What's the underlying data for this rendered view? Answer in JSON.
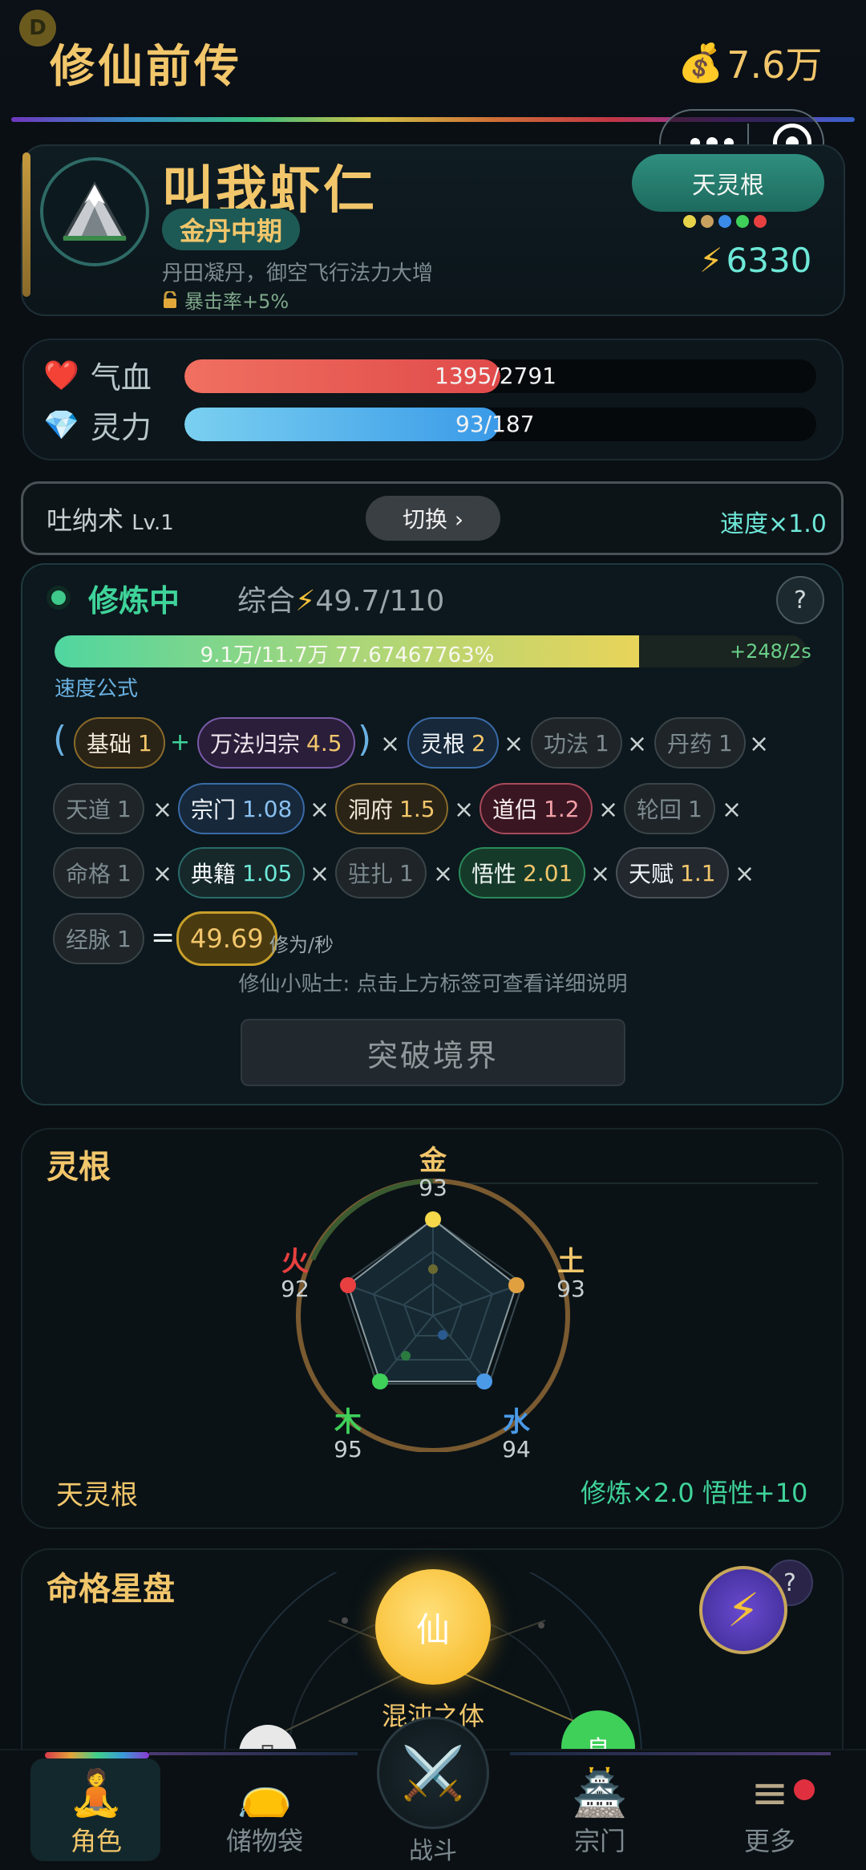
{
  "header": {
    "badge": "D",
    "title": "修仙前传",
    "money_icon": "money-bag-icon",
    "money": "7.6万"
  },
  "mini_program": {
    "more_icon": "more-dots-icon",
    "close_icon": "target-close-icon"
  },
  "profile": {
    "name": "叫我虾仁",
    "realm": "金丹中期",
    "realm_desc": "丹田凝丹，御空飞行法力大增",
    "bonus": "暴击率+5%",
    "root_tag": "天灵根",
    "root_dot_colors": [
      "#e5d44a",
      "#c8a060",
      "#3a8ae8",
      "#3fd05a",
      "#e84040"
    ],
    "power": "6330"
  },
  "stats": {
    "hp": {
      "label": "气血",
      "current": "1395",
      "max": "/2791",
      "fraction": 0.4998
    },
    "mp": {
      "label": "灵力",
      "current": "93",
      "max": "/187",
      "fraction": 0.4973
    }
  },
  "breathing": {
    "name": "吐纳术",
    "level": "Lv.1",
    "switch_label": "切换 ›",
    "speed": "速度×1.0"
  },
  "cultivation": {
    "status": "修炼中",
    "combo_label": "综合",
    "combo_value": "49.7/110",
    "help": "?",
    "progress_text": "9.1万/11.7万  77.67467763%",
    "progress_fraction": 0.7767,
    "gain": "+248/2s",
    "formula_label": "速度公式",
    "open_paren": "(",
    "close_paren": ")",
    "plus": "+",
    "times": "×",
    "equals": "=",
    "factors": {
      "base": {
        "name": "基础",
        "value": "1"
      },
      "wanfa": {
        "name": "万法归宗",
        "value": "4.5"
      },
      "linggen": {
        "name": "灵根",
        "value": "2"
      },
      "gongfa": {
        "name": "功法",
        "value": "1"
      },
      "danyao": {
        "name": "丹药",
        "value": "1"
      },
      "tiandao": {
        "name": "天道",
        "value": "1"
      },
      "zongmen": {
        "name": "宗门",
        "value": "1.08"
      },
      "dongfu": {
        "name": "洞府",
        "value": "1.5"
      },
      "daolv": {
        "name": "道侣",
        "value": "1.2"
      },
      "lunhui": {
        "name": "轮回",
        "value": "1"
      },
      "mingge": {
        "name": "命格",
        "value": "1"
      },
      "dianji": {
        "name": "典籍",
        "value": "1.05"
      },
      "zhuzha": {
        "name": "驻扎",
        "value": "1"
      },
      "wuxing": {
        "name": "悟性",
        "value": "2.01"
      },
      "tianfu": {
        "name": "天赋",
        "value": "1.1"
      },
      "jingmai": {
        "name": "经脉",
        "value": "1"
      }
    },
    "result": "49.69",
    "result_unit": "修为/秒",
    "tip": "修仙小贴士: 点击上方标签可查看详细说明",
    "break_label": "突破境界"
  },
  "spirit_root": {
    "title": "灵根",
    "elements": [
      {
        "name": "金",
        "value": "93",
        "color": "#f2c66b"
      },
      {
        "name": "土",
        "value": "93",
        "color": "#f2c66b"
      },
      {
        "name": "水",
        "value": "94",
        "color": "#4a9ae8"
      },
      {
        "name": "木",
        "value": "95",
        "color": "#3fd05a"
      },
      {
        "name": "火",
        "value": "92",
        "color": "#e84040"
      }
    ],
    "footer_left": "天灵根",
    "footer_right": "修炼×2.0  悟性+10"
  },
  "fate": {
    "title": "命格星盘",
    "help": "?",
    "center": "仙",
    "body": "混沌之体",
    "left_node": "凡",
    "right_node": "良"
  },
  "nav": {
    "items": [
      {
        "label": "角色",
        "icon": "meditating-figure-icon"
      },
      {
        "label": "储物袋",
        "icon": "storage-bag-icon"
      },
      {
        "label": "战斗",
        "icon": "crossed-swords-icon"
      },
      {
        "label": "宗门",
        "icon": "temple-icon"
      },
      {
        "label": "更多",
        "icon": "menu-icon"
      }
    ]
  }
}
